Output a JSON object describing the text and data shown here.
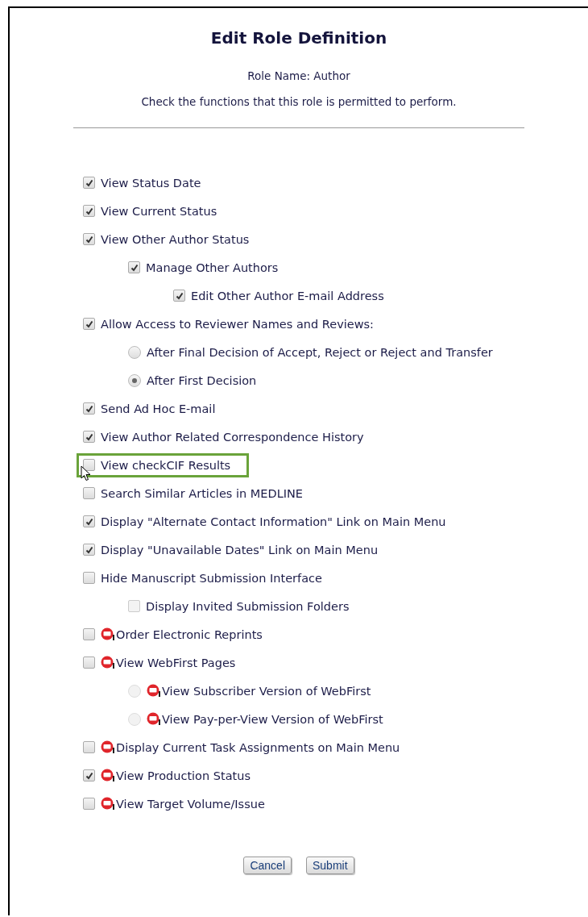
{
  "title": "Edit Role Definition",
  "role_name": "Role Name: Author",
  "instruction": "Check the functions that this role is permitted to perform.",
  "functions": [
    {
      "label": "View Status Date",
      "kind": "checkbox",
      "checked": true,
      "disabled": false,
      "highlighted": false,
      "production_icon": false
    },
    {
      "label": "View Current Status",
      "kind": "checkbox",
      "checked": true,
      "disabled": false,
      "highlighted": false,
      "production_icon": false
    },
    {
      "label": "View Other Author Status",
      "kind": "checkbox",
      "checked": true,
      "disabled": false,
      "highlighted": false,
      "production_icon": false,
      "children": [
        {
          "label": "Manage Other Authors",
          "kind": "checkbox",
          "checked": true,
          "disabled": false,
          "highlighted": false,
          "production_icon": false,
          "children": [
            {
              "label": "Edit Other Author E-mail Address",
              "kind": "checkbox",
              "checked": true,
              "disabled": false,
              "highlighted": false,
              "production_icon": false
            }
          ]
        }
      ]
    },
    {
      "label": "Allow Access to Reviewer Names and Reviews:",
      "kind": "checkbox",
      "checked": true,
      "disabled": false,
      "highlighted": false,
      "production_icon": false,
      "children": [
        {
          "label": "After Final Decision of Accept, Reject or Reject and Transfer",
          "kind": "radio",
          "selected": false,
          "disabled": false,
          "highlighted": false,
          "production_icon": false
        },
        {
          "label": "After First Decision",
          "kind": "radio",
          "selected": true,
          "disabled": false,
          "highlighted": false,
          "production_icon": false
        }
      ]
    },
    {
      "label": "Send Ad Hoc E-mail",
      "kind": "checkbox",
      "checked": true,
      "disabled": false,
      "highlighted": false,
      "production_icon": false
    },
    {
      "label": "View Author Related Correspondence History",
      "kind": "checkbox",
      "checked": true,
      "disabled": false,
      "highlighted": false,
      "production_icon": false
    },
    {
      "label": "View checkCIF Results",
      "kind": "checkbox",
      "checked": false,
      "disabled": false,
      "highlighted": true,
      "production_icon": false
    },
    {
      "label": "Search Similar Articles in MEDLINE",
      "kind": "checkbox",
      "checked": false,
      "disabled": false,
      "highlighted": false,
      "production_icon": false
    },
    {
      "label": "Display \"Alternate Contact Information\" Link on Main Menu",
      "kind": "checkbox",
      "checked": true,
      "disabled": false,
      "highlighted": false,
      "production_icon": false
    },
    {
      "label": "Display \"Unavailable Dates\" Link on Main Menu",
      "kind": "checkbox",
      "checked": true,
      "disabled": false,
      "highlighted": false,
      "production_icon": false
    },
    {
      "label": "Hide Manuscript Submission Interface",
      "kind": "checkbox",
      "checked": false,
      "disabled": false,
      "highlighted": false,
      "production_icon": false,
      "children": [
        {
          "label": "Display Invited Submission Folders",
          "kind": "checkbox",
          "checked": false,
          "disabled": true,
          "highlighted": false,
          "production_icon": false
        }
      ]
    },
    {
      "label": "Order Electronic Reprints",
      "kind": "checkbox",
      "checked": false,
      "disabled": false,
      "highlighted": false,
      "production_icon": true
    },
    {
      "label": "View WebFirst Pages",
      "kind": "checkbox",
      "checked": false,
      "disabled": false,
      "highlighted": false,
      "production_icon": true,
      "children": [
        {
          "label": "View Subscriber Version of WebFirst",
          "kind": "radio",
          "selected": false,
          "disabled": true,
          "highlighted": false,
          "production_icon": true
        },
        {
          "label": "View Pay-per-View Version of WebFirst",
          "kind": "radio",
          "selected": false,
          "disabled": true,
          "highlighted": false,
          "production_icon": true
        }
      ]
    },
    {
      "label": "Display Current Task Assignments on Main Menu",
      "kind": "checkbox",
      "checked": false,
      "disabled": false,
      "highlighted": false,
      "production_icon": true
    },
    {
      "label": "View Production Status",
      "kind": "checkbox",
      "checked": true,
      "disabled": false,
      "highlighted": false,
      "production_icon": true
    },
    {
      "label": "View Target Volume/Issue",
      "kind": "checkbox",
      "checked": false,
      "disabled": false,
      "highlighted": false,
      "production_icon": true
    }
  ],
  "buttons": [
    "Cancel",
    "Submit"
  ]
}
